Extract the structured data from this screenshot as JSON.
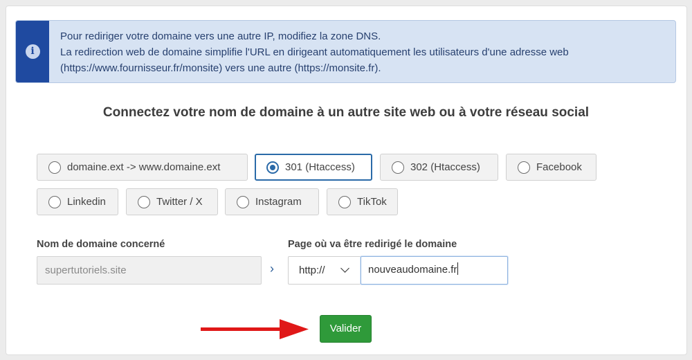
{
  "alert": {
    "icon": "info-icon",
    "line1": "Pour rediriger votre domaine vers une autre IP, modifiez la zone DNS.",
    "line2": "La redirection web de domaine simplifie l'URL en dirigeant automatiquement les utilisateurs d'une adresse web",
    "line3": "(https://www.fournisseur.fr/monsite) vers une autre (https://monsite.fr)."
  },
  "heading": "Connectez votre nom de domaine à un autre site web ou à votre réseau social",
  "options": [
    {
      "label": "domaine.ext -> www.domaine.ext",
      "selected": false
    },
    {
      "label": "301 (Htaccess)",
      "selected": true
    },
    {
      "label": "302 (Htaccess)",
      "selected": false
    },
    {
      "label": "Facebook",
      "selected": false
    },
    {
      "label": "Linkedin",
      "selected": false
    },
    {
      "label": "Twitter / X",
      "selected": false
    },
    {
      "label": "Instagram",
      "selected": false
    },
    {
      "label": "TikTok",
      "selected": false
    }
  ],
  "form": {
    "domain_label": "Nom de domaine concerné",
    "domain_placeholder": "supertutoriels.site",
    "target_label": "Page où va être redirigé le domaine",
    "protocol": "http://",
    "target_value": "nouveaudomaine.fr"
  },
  "submit_label": "Valider",
  "colors": {
    "alert_bg": "#d7e3f3",
    "alert_side": "#1f4aa0",
    "selected_border": "#2a6aa8",
    "submit_bg": "#2f9a3a",
    "arrow": "#e01818"
  }
}
